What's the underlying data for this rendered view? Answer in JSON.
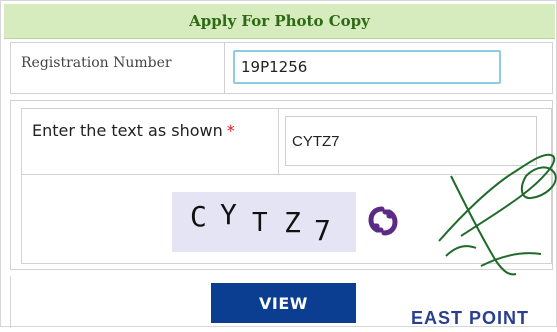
{
  "header": {
    "title": "Apply For Photo Copy"
  },
  "registration": {
    "label": "Registration Number",
    "value": "19P1256"
  },
  "captcha": {
    "label": "Enter the text as shown",
    "required_marker": "*",
    "input_value": "CYTZ7",
    "chars": [
      "C",
      "Y",
      "T",
      "Z",
      "7"
    ]
  },
  "actions": {
    "view_label": "VIEW"
  },
  "watermark": {
    "text": "EAST POINT"
  },
  "icons": {
    "refresh": "refresh-icon"
  },
  "colors": {
    "header_bg": "#d6ecbe",
    "header_text": "#2d6a14",
    "button_bg": "#0b3d91",
    "refresh_icon": "#5b2a86",
    "signature": "#1f6b2a"
  }
}
